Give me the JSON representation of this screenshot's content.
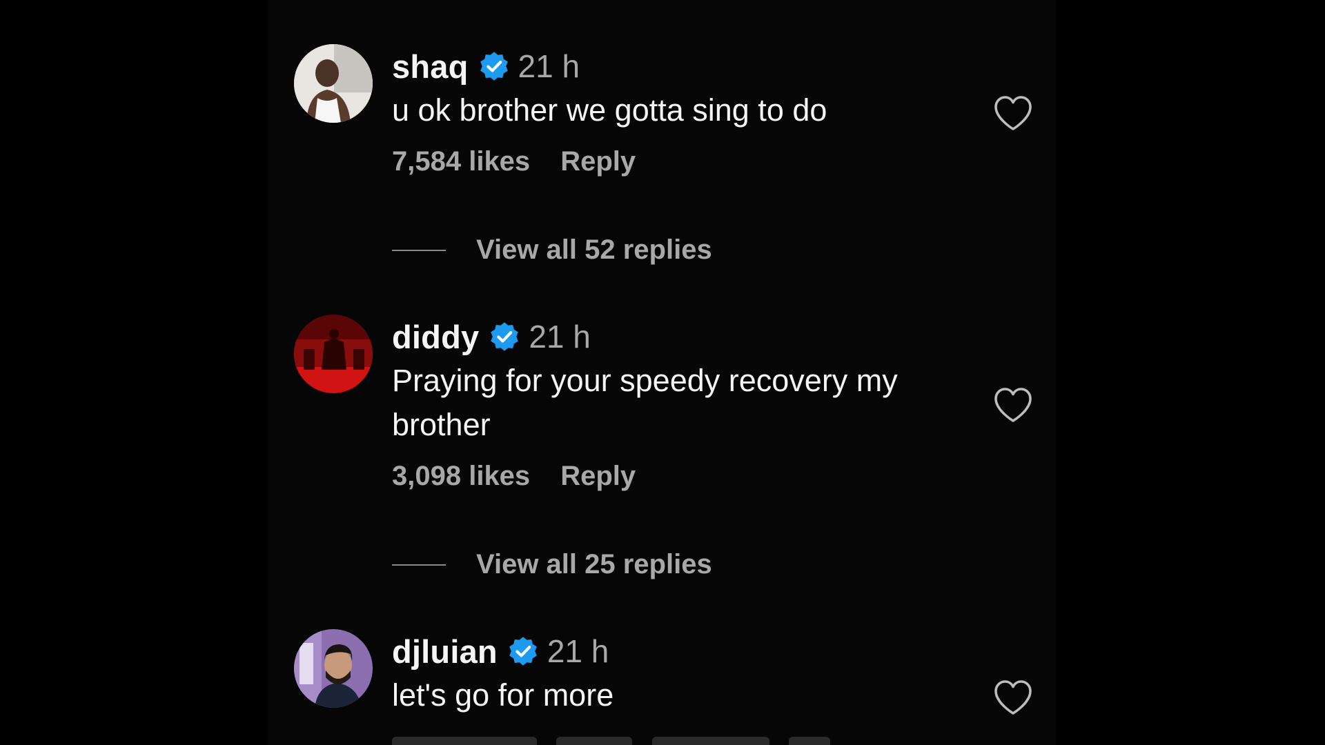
{
  "comments": [
    {
      "username": "shaq",
      "time": "21 h",
      "text": "u ok brother we gotta sing to do",
      "likes": "7,584 likes",
      "reply_label": "Reply",
      "view_replies": "View all 52 replies",
      "verified": true
    },
    {
      "username": "diddy",
      "time": "21 h",
      "text": "Praying for your speedy recovery my brother",
      "likes": "3,098 likes",
      "reply_label": "Reply",
      "view_replies": "View all 25 replies",
      "verified": true
    },
    {
      "username": "djluian",
      "time": "21 h",
      "text": "let's go for more",
      "verified": true
    }
  ],
  "colors": {
    "background": "#000000",
    "primary_text": "#f5f5f5",
    "secondary_text": "#a8a8a8",
    "verified_blue": "#1d9bf0"
  },
  "icons": {
    "verified": "verified-badge-icon",
    "like": "heart-outline-icon"
  }
}
